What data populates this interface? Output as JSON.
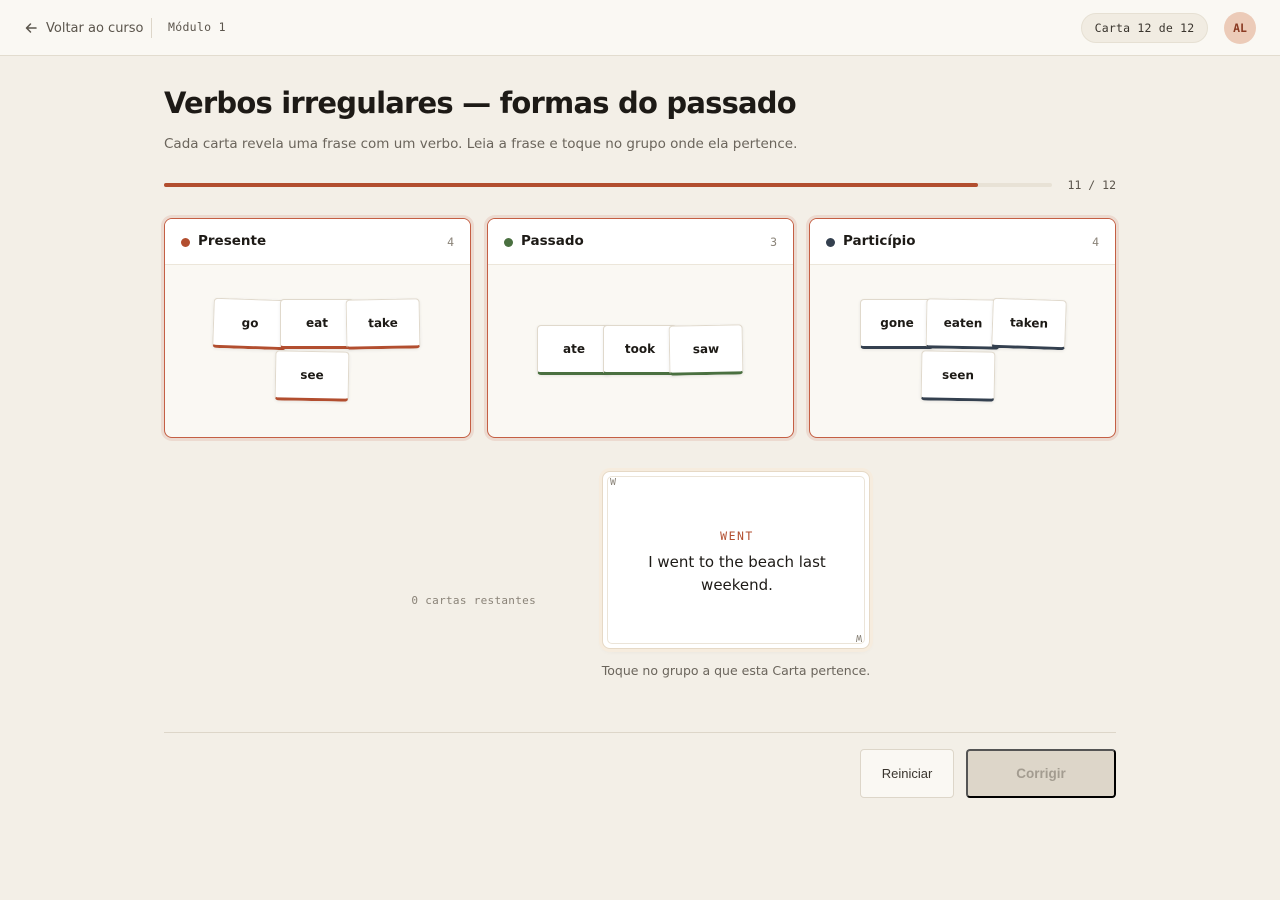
{
  "header": {
    "back_label": "Voltar ao curso",
    "module_label": "Módulo 1",
    "card_counter": "Carta 12 de 12",
    "avatar_initials": "AL"
  },
  "page": {
    "title": "Verbos irregulares — formas do passado",
    "subtitle": "Cada carta revela uma frase com um verbo. Leia a frase e toque no grupo onde ela pertence."
  },
  "progress": {
    "text": "11 / 12",
    "current": 11,
    "total": 12
  },
  "groups": [
    {
      "name": "Presente",
      "count": "4",
      "color": "#b24e2f",
      "chips": [
        "go",
        "eat",
        "take",
        "see"
      ]
    },
    {
      "name": "Passado",
      "count": "3",
      "color": "#4a7040",
      "chips": [
        "ate",
        "took",
        "saw"
      ]
    },
    {
      "name": "Particípio",
      "count": "4",
      "color": "#34404f",
      "chips": [
        "gone",
        "eaten",
        "taken",
        "seen"
      ]
    }
  ],
  "deck": {
    "remaining": "0 cartas restantes",
    "corner_top": "W",
    "corner_bottom": "W",
    "verb": "WENT",
    "sentence": "I went to the beach last weekend.",
    "hint": "Toque no grupo a que esta Carta pertence."
  },
  "actions": {
    "reset": "Reiniciar",
    "check": "Corrigir"
  },
  "colors": {
    "accent": "#b24e2f",
    "green": "#4a7040",
    "navy": "#34404f"
  }
}
